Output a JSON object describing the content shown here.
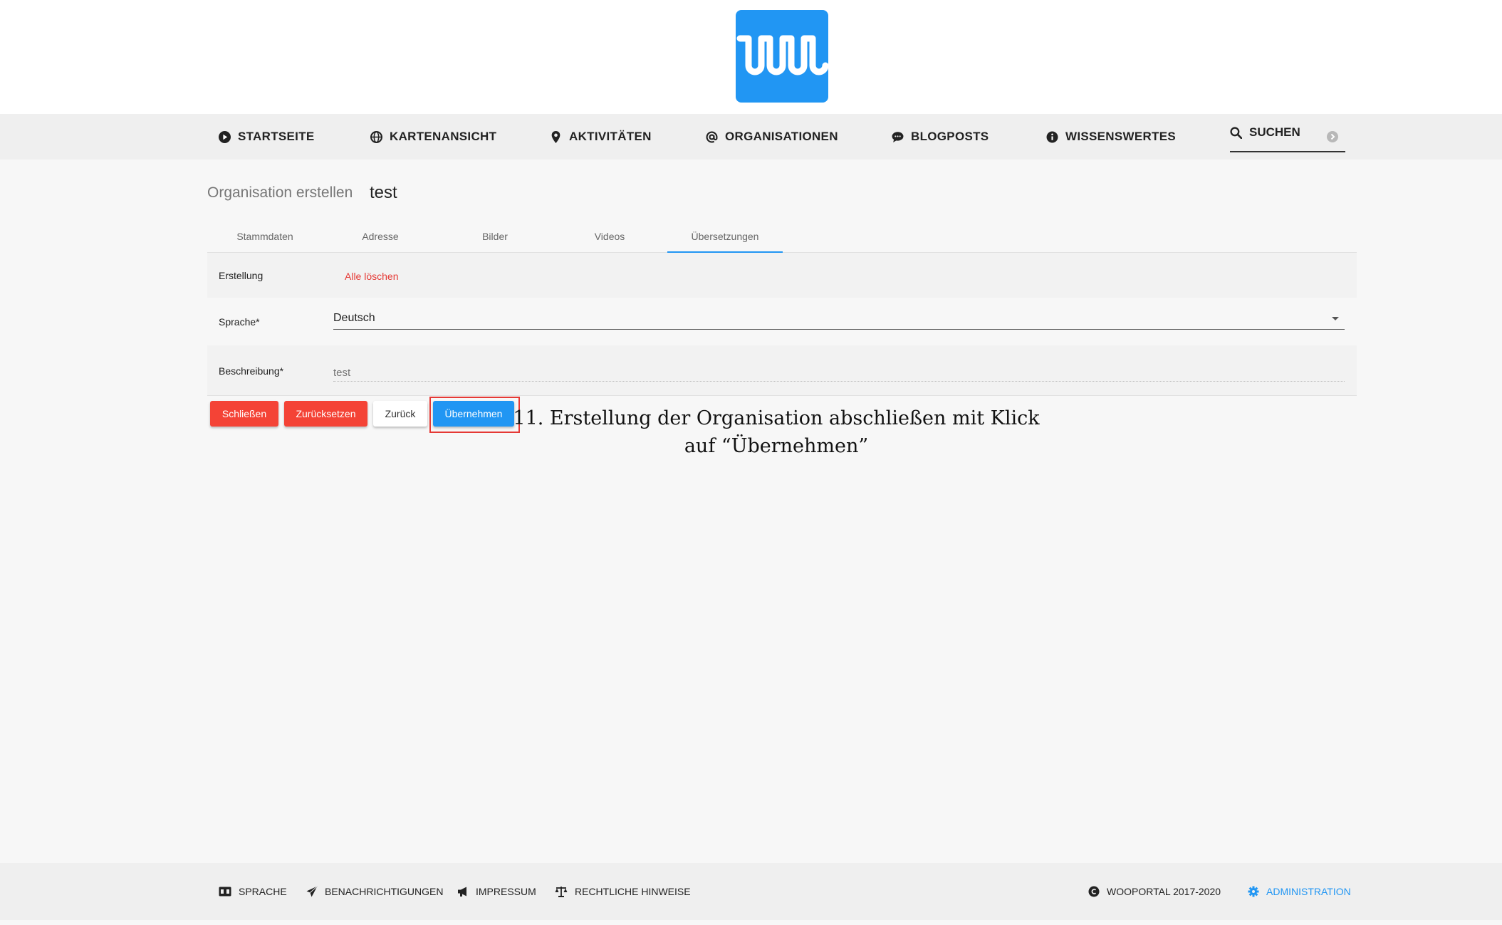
{
  "nav": {
    "items": [
      {
        "label": "STARTSEITE",
        "icon": "play-circle-icon"
      },
      {
        "label": "KARTENANSICHT",
        "icon": "globe-icon"
      },
      {
        "label": "AKTIVITÄTEN",
        "icon": "map-marker-icon"
      },
      {
        "label": "ORGANISATIONEN",
        "icon": "at-icon"
      },
      {
        "label": "BLOGPOSTS",
        "icon": "comment-icon"
      },
      {
        "label": "WISSENSWERTES",
        "icon": "info-icon"
      }
    ],
    "search": {
      "placeholder": "SUCHEN",
      "icon": "search-icon"
    }
  },
  "form": {
    "title": "Organisation erstellen",
    "name": "test",
    "tabs": [
      {
        "label": "Stammdaten"
      },
      {
        "label": "Adresse"
      },
      {
        "label": "Bilder"
      },
      {
        "label": "Videos"
      },
      {
        "label": "Übersetzungen",
        "active": true
      }
    ],
    "creation_label": "Erstellung",
    "clear_all": "Alle löschen",
    "language_label": "Sprache*",
    "language_value": "Deutsch",
    "description_label": "Beschreibung*",
    "description_placeholder": "test"
  },
  "buttons": {
    "close": "Schließen",
    "reset": "Zurücksetzen",
    "back": "Zurück",
    "apply": "Übernehmen"
  },
  "annotation": {
    "line1": "11. Erstellung der Organisation abschließen mit Klick",
    "line2": "auf “Übernehmen”"
  },
  "footer": {
    "language": "SPRACHE",
    "notifications": "BENACHRICHTIGUNGEN",
    "imprint": "IMPRESSUM",
    "legal": "RECHTLICHE HINWEISE",
    "copyright": "WOOPORTAL 2017-2020",
    "admin": "ADMINISTRATION"
  },
  "colors": {
    "accent": "#2196f3",
    "danger": "#f44336",
    "highlight": "#e53935"
  }
}
